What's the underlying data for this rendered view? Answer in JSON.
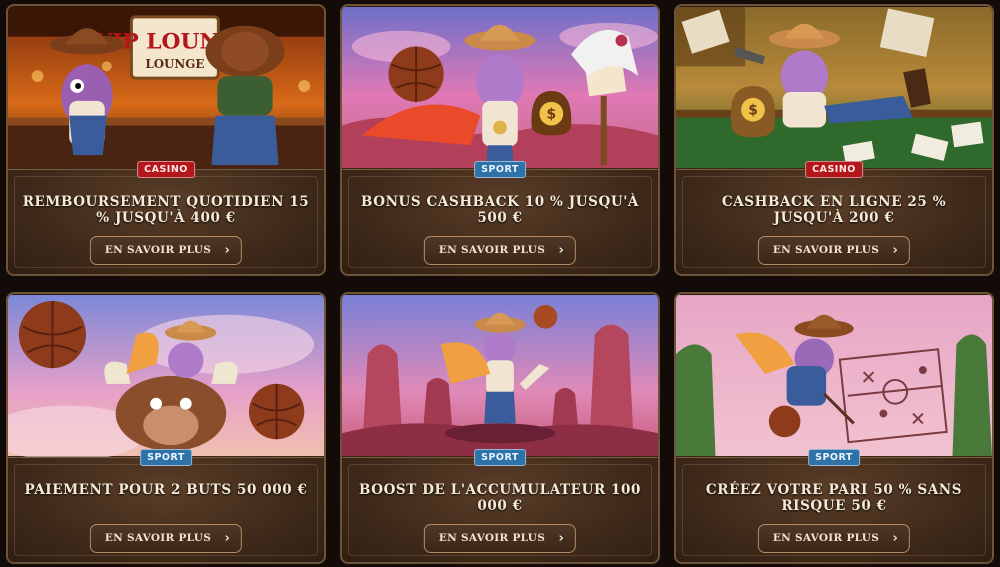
{
  "cards": [
    {
      "badge": "CASINO",
      "badge_type": "casino",
      "title": "REMBOURSEMENT QUOTIDIEN 15 % JUSQU'À 400 €",
      "button": "EN SAVOIR PLUS",
      "art_text": "VIP LOUNGE",
      "art_icon": "cowboy-lizard-vip-lounge-icon"
    },
    {
      "badge": "SPORT",
      "badge_type": "sport",
      "title": "BONUS CASHBACK 10 % JUSQU'À 500 €",
      "button": "EN SAVOIR PLUS",
      "art_icon": "cowboy-lizard-money-bag-icon"
    },
    {
      "badge": "CASINO",
      "badge_type": "casino",
      "title": "CASHBACK EN LIGNE 25 % JUSQU'À 200 €",
      "button": "EN SAVOIR PLUS",
      "art_icon": "cowboy-lizard-poker-table-icon"
    },
    {
      "badge": "SPORT",
      "badge_type": "sport",
      "title": "PAIEMENT POUR 2 BUTS 50 000 €",
      "button": "EN SAVOIR PLUS",
      "art_icon": "cowboy-lizard-bull-ride-icon"
    },
    {
      "badge": "SPORT",
      "badge_type": "sport",
      "title": "BOOST DE L'ACCUMULATEUR 100 000 €",
      "button": "EN SAVOIR PLUS",
      "art_icon": "cowboy-lizard-canyon-icon"
    },
    {
      "badge": "SPORT",
      "badge_type": "sport",
      "title": "CRÉEZ VOTRE PARI 50 % SANS RISQUE 50 €",
      "button": "EN SAVOIR PLUS",
      "art_icon": "cowboy-lizard-tactics-board-icon"
    }
  ],
  "colors": {
    "casino_badge": "#b3171b",
    "sport_badge": "#2e72a8",
    "card_bg": "#3d2818",
    "text": "#f6ead8"
  }
}
